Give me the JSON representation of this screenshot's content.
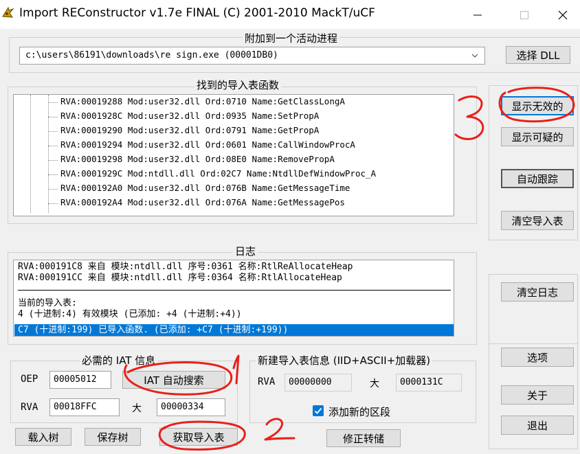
{
  "window": {
    "title": "Import REConstructor v1.7e FINAL (C) 2001-2010 MackT/uCF"
  },
  "process_group": {
    "title": "附加到一个活动进程",
    "process_value": "c:\\users\\86191\\downloads\\re sign.exe (00001DB0)",
    "pick_dll_label": "选择 DLL"
  },
  "imports_group": {
    "title": "找到的导入表函数",
    "rows": [
      "RVA:00019288 Mod:user32.dll Ord:0710 Name:GetClassLongA",
      "RVA:0001928C Mod:user32.dll Ord:0935 Name:SetPropA",
      "RVA:00019290 Mod:user32.dll Ord:0791 Name:GetPropA",
      "RVA:00019294 Mod:user32.dll Ord:0601 Name:CallWindowProcA",
      "RVA:00019298 Mod:user32.dll Ord:08E0 Name:RemovePropA",
      "RVA:0001929C Mod:ntdll.dll Ord:02C7 Name:NtdllDefWindowProc_A",
      "RVA:000192A0 Mod:user32.dll Ord:076B Name:GetMessageTime",
      "RVA:000192A4 Mod:user32.dll Ord:076A Name:GetMessagePos"
    ]
  },
  "right_buttons": {
    "show_invalid": "显示无效的",
    "show_suspect": "显示可疑的",
    "auto_trace": "自动跟踪",
    "clear_imports": "清空导入表",
    "clear_log": "清空日志",
    "options": "选项",
    "about": "关于",
    "exit": "退出"
  },
  "log_group": {
    "title": "日志",
    "lines": [
      "RVA:000191C8 来自 模块:ntdll.dll 序号:0361 名称:RtlReAllocateHeap",
      "RVA:000191CC 来自 模块:ntdll.dll 序号:0364 名称:RtlAllocateHeap",
      "当前的导入表:",
      "4 (十进制:4) 有效模块 (已添加: +4 (十进制:+4))"
    ],
    "selected_line": "C7 (十进制:199) 已导入函数. (已添加: +C7 (十进制:+199))"
  },
  "iat_group": {
    "title": "必需的 IAT 信息",
    "oep_label": "OEP",
    "oep_value": "00005012",
    "iat_autosearch": "IAT 自动搜索",
    "rva_label": "RVA",
    "rva_value": "00018FFC",
    "size_label": "大",
    "size_value": "00000334"
  },
  "new_import_group": {
    "title": "新建导入表信息 (IID+ASCII+加载器)",
    "rva_label": "RVA",
    "rva_value": "00000000",
    "size_label": "大",
    "size_value": "0000131C",
    "add_section_label": "添加新的区段"
  },
  "bottom_buttons": {
    "load_tree": "载入树",
    "save_tree": "保存树",
    "get_imports": "获取导入表",
    "fix_dump": "修正转储"
  },
  "annotations": {
    "mark_1": "1",
    "mark_2": "2",
    "mark_3": "3",
    "color": "#e8201a"
  },
  "colors": {
    "selection": "#0078d7",
    "button_face": "#e1e1e1",
    "window_bg": "#f0f0f0"
  }
}
